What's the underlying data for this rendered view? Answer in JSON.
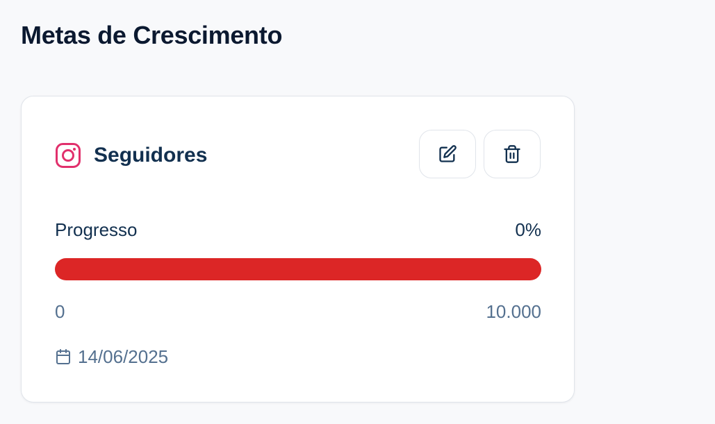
{
  "page": {
    "title": "Metas de Crescimento"
  },
  "goal_card": {
    "platform_icon": "instagram-icon",
    "title": "Seguidores",
    "actions": {
      "edit_icon": "edit-icon",
      "delete_icon": "trash-icon"
    },
    "progress": {
      "label": "Progresso",
      "value_text": "0%",
      "fraction": 0
    },
    "range": {
      "min": "0",
      "max": "10.000"
    },
    "date": {
      "icon": "calendar-icon",
      "value": "14/06/2025"
    }
  },
  "colors": {
    "instagram": "#e1306c",
    "progress_track": "#dc2626",
    "progress_fill": "#16a34a",
    "title_text": "#0b1930",
    "muted_text": "#54708f"
  }
}
